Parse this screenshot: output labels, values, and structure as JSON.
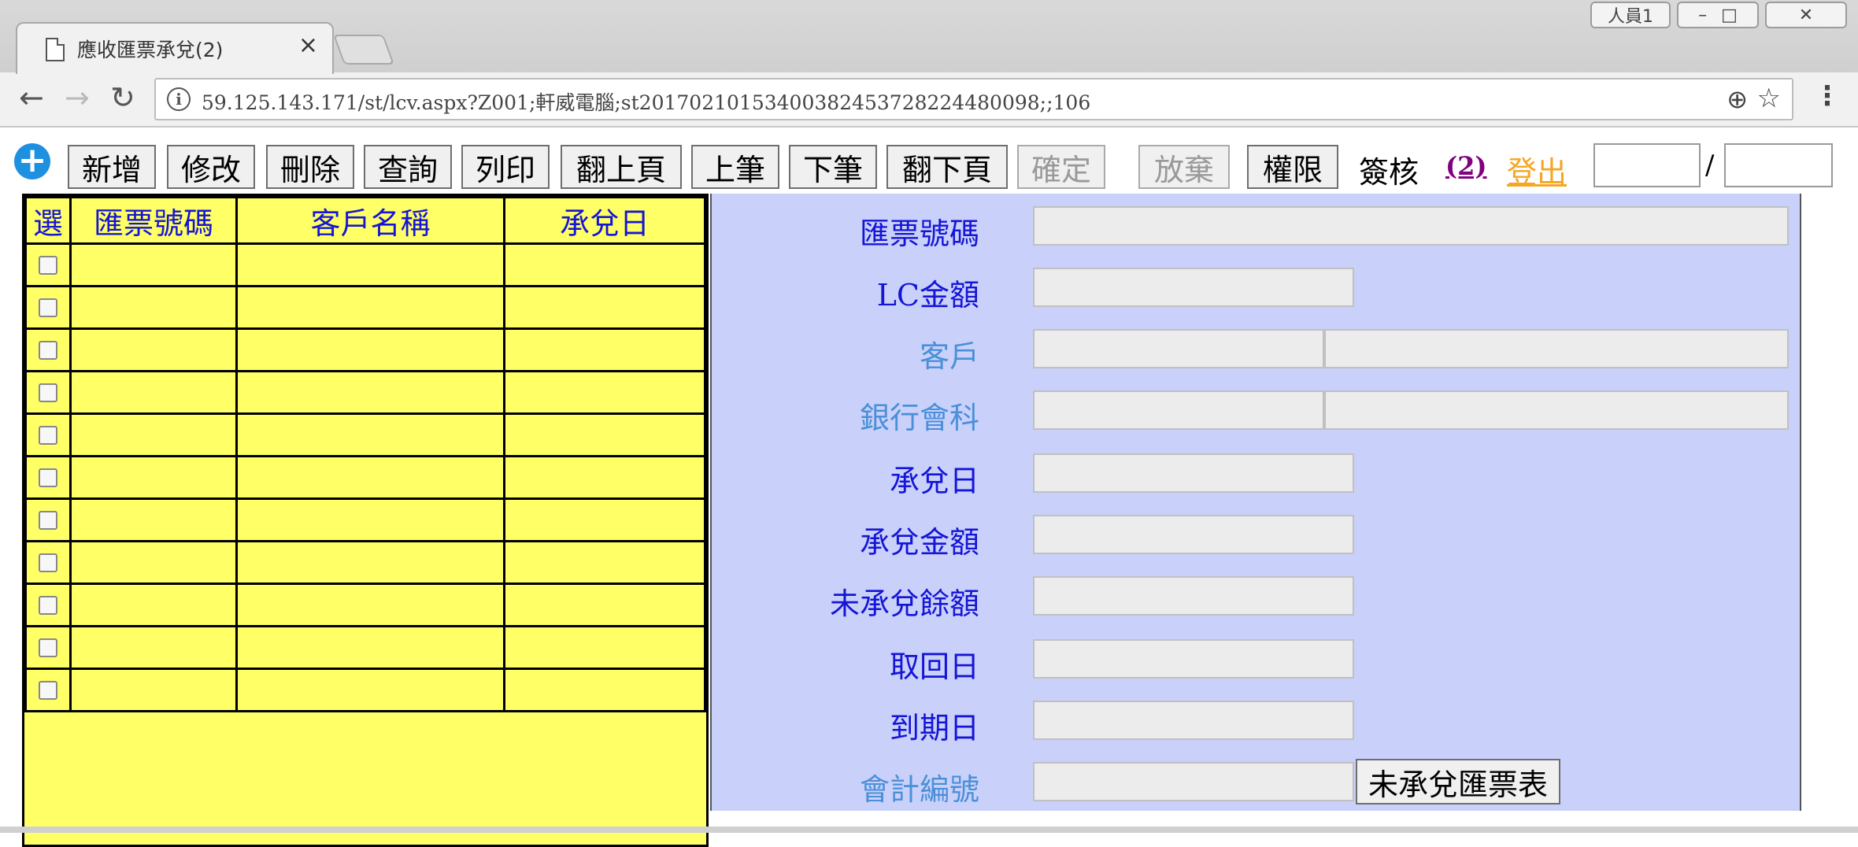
{
  "browser": {
    "tab_title": "應收匯票承兌(2)",
    "tab_close": "×",
    "profile_label": "人員1",
    "url": "59.125.143.171/st/lcv.aspx?Z001;軒威電腦;st20170210153400382453728224480098;;106"
  },
  "toolbar": {
    "add": "新增",
    "edit": "修改",
    "delete": "刪除",
    "query": "查詢",
    "print": "列印",
    "prev_page": "翻上頁",
    "prev_record": "上筆",
    "next_record": "下筆",
    "next_page": "翻下頁",
    "confirm": "確定",
    "cancel": "放棄",
    "permission": "權限",
    "sign_label": "簽核",
    "sign_count": "(2)",
    "logout": "登出",
    "page_separator": "/"
  },
  "grid": {
    "columns": [
      "選",
      "匯票號碼",
      "客戶名稱",
      "承兌日"
    ],
    "rows": [
      {
        "selected": false,
        "draft_no": "",
        "customer": "",
        "accept_date": ""
      },
      {
        "selected": false,
        "draft_no": "",
        "customer": "",
        "accept_date": ""
      },
      {
        "selected": false,
        "draft_no": "",
        "customer": "",
        "accept_date": ""
      },
      {
        "selected": false,
        "draft_no": "",
        "customer": "",
        "accept_date": ""
      },
      {
        "selected": false,
        "draft_no": "",
        "customer": "",
        "accept_date": ""
      },
      {
        "selected": false,
        "draft_no": "",
        "customer": "",
        "accept_date": ""
      },
      {
        "selected": false,
        "draft_no": "",
        "customer": "",
        "accept_date": ""
      },
      {
        "selected": false,
        "draft_no": "",
        "customer": "",
        "accept_date": ""
      },
      {
        "selected": false,
        "draft_no": "",
        "customer": "",
        "accept_date": ""
      },
      {
        "selected": false,
        "draft_no": "",
        "customer": "",
        "accept_date": ""
      },
      {
        "selected": false,
        "draft_no": "",
        "customer": "",
        "accept_date": ""
      }
    ]
  },
  "form": {
    "draft_no": "匯票號碼",
    "lc_amount": "LC金額",
    "customer": "客戶",
    "bank_account": "銀行會科",
    "accept_date": "承兌日",
    "accept_amount": "承兌金額",
    "unaccepted_balance": "未承兌餘額",
    "retrieve_date": "取回日",
    "due_date": "到期日",
    "account_no": "會計編號",
    "report_button": "未承兌匯票表"
  },
  "colors": {
    "grid_bg": "#ffff66",
    "form_bg": "#c9d1fa",
    "label_blue": "#1515d6",
    "label_light_blue": "#4a8fd8",
    "logout_orange": "#f5a623",
    "sign_purple": "#800080"
  }
}
